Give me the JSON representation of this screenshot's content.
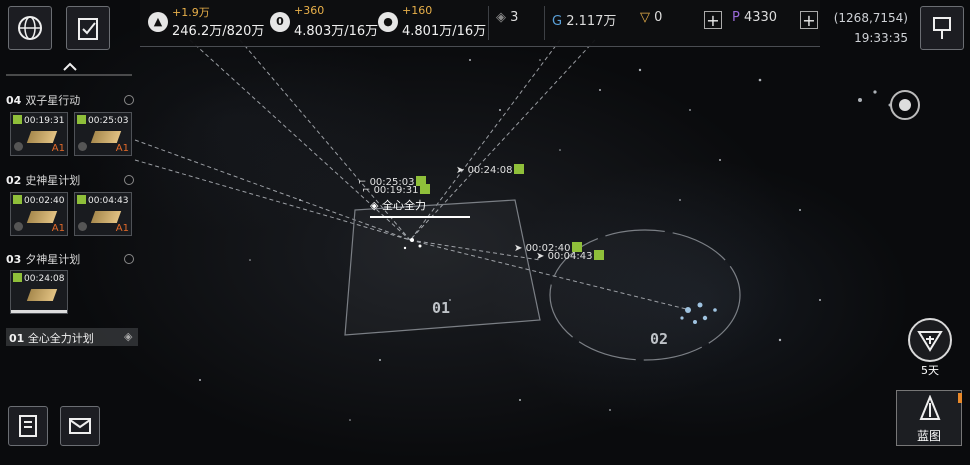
{
  "header": {
    "resources": [
      {
        "icon": "triangle-icon",
        "delta": "+1.9万",
        "amount": "246.2万/820万"
      },
      {
        "icon": "crystal-icon",
        "delta": "+360",
        "amount": "4.803万/16万"
      },
      {
        "icon": "orb-icon",
        "delta": "+160",
        "amount": "4.801万/16万"
      }
    ],
    "rank_value": "3",
    "credits": "2.117万",
    "tokens": "0",
    "premium": "4330",
    "coords": "(1268,7154)",
    "clock": "19:33:35"
  },
  "sidebar": {
    "groups": [
      {
        "num": "04",
        "title": "双子星行动",
        "timers": [
          "00:19:31",
          "00:25:03"
        ]
      },
      {
        "num": "02",
        "title": "史神星计划",
        "timers": [
          "00:02:40",
          "00:04:43"
        ]
      },
      {
        "num": "03",
        "title": "夕神星计划",
        "timers": [
          "00:24:08"
        ]
      }
    ],
    "plan": {
      "num": "01",
      "title": "全心全力计划"
    }
  },
  "map": {
    "fleets": [
      {
        "time": "00:25:03"
      },
      {
        "time": "00:19:31"
      },
      {
        "time": "00:24:08"
      },
      {
        "time": "00:02:40"
      },
      {
        "time": "00:04:43"
      }
    ],
    "selected_fleet": "全心全力",
    "sectors": [
      "01",
      "02"
    ]
  },
  "right": {
    "days_label": "5天",
    "blueprint_label": "蓝图"
  },
  "colors": {
    "timer_green": "#8fbf3a",
    "accent_orange": "#e8b04a"
  }
}
